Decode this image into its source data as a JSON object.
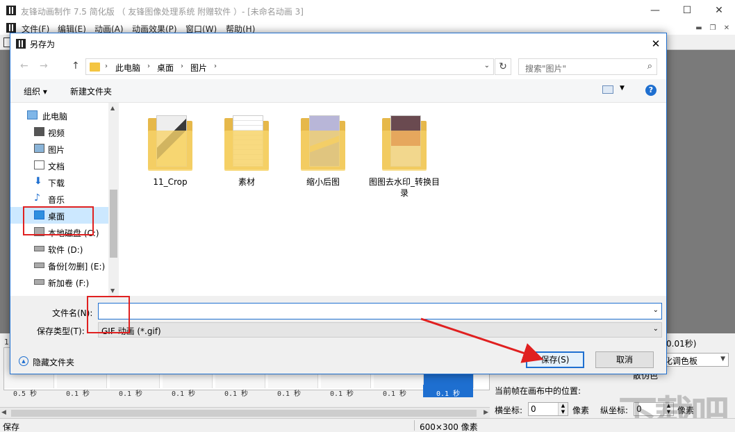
{
  "main_window": {
    "title": "友锋动画制作 7.5 简化版 （ 友锋图像处理系统 附赠软件 ）- [未命名动画 3]",
    "controls": {
      "minimize": "—",
      "maximize": "☐",
      "close": "✕"
    },
    "menu": [
      "文件(F)",
      "编辑(E)",
      "动画(A)",
      "动画效果(P)",
      "窗口(W)",
      "帮助(H)"
    ],
    "mdi_controls": {
      "minimize": "▬",
      "restore": "❐",
      "close": "✕"
    }
  },
  "frames": {
    "first_index": "1",
    "times": [
      "0.5 秒",
      "0.1 秒",
      "0.1 秒",
      "0.1 秒",
      "0.1 秒",
      "0.1 秒",
      "0.1 秒",
      "0.1 秒",
      "0.1 秒"
    ],
    "selected_index": 8
  },
  "right_panel": {
    "delay_hint": "0.01秒)",
    "palette_value": "化调色板",
    "dither_label": "散伪色",
    "position_label": "当前帧在画布中的位置:",
    "x_label": "横坐标:",
    "x_value": "0",
    "unit": "像素",
    "y_label": "纵坐标:",
    "y_value": "0",
    "unit2": "像素"
  },
  "statusbar": {
    "left": "保存",
    "size": "600×300 像素"
  },
  "dialog": {
    "title": "另存为",
    "close": "✕",
    "nav": {
      "back": "←",
      "forward": "→",
      "up": "↑"
    },
    "breadcrumb": [
      "此电脑",
      "桌面",
      "图片"
    ],
    "search_placeholder": "搜索\"图片\"",
    "organize": "组织 ▾",
    "new_folder": "新建文件夹",
    "help": "?",
    "nav_items": [
      "此电脑",
      "视频",
      "图片",
      "文档",
      "下载",
      "音乐",
      "桌面",
      "本地磁盘 (C:)",
      "软件 (D:)",
      "备份[勿删] (E:)",
      "新加卷 (F:)"
    ],
    "nav_selected": 6,
    "files": [
      {
        "name": "11_Crop"
      },
      {
        "name": "素材"
      },
      {
        "name": "缩小后图"
      },
      {
        "name": "图图去水印_转换目录"
      }
    ],
    "filename_label": "文件名(N):",
    "filename_value": "",
    "filetype_label": "保存类型(T):",
    "filetype_value": "GIF 动画 (*.gif)",
    "hide_folders": "隐藏文件夹",
    "save": "保存(S)",
    "cancel": "取消"
  },
  "watermark": "下载吧",
  "colors": {
    "accent": "#1e6fd0",
    "highlight": "#e02020",
    "selection": "#cce8ff"
  }
}
